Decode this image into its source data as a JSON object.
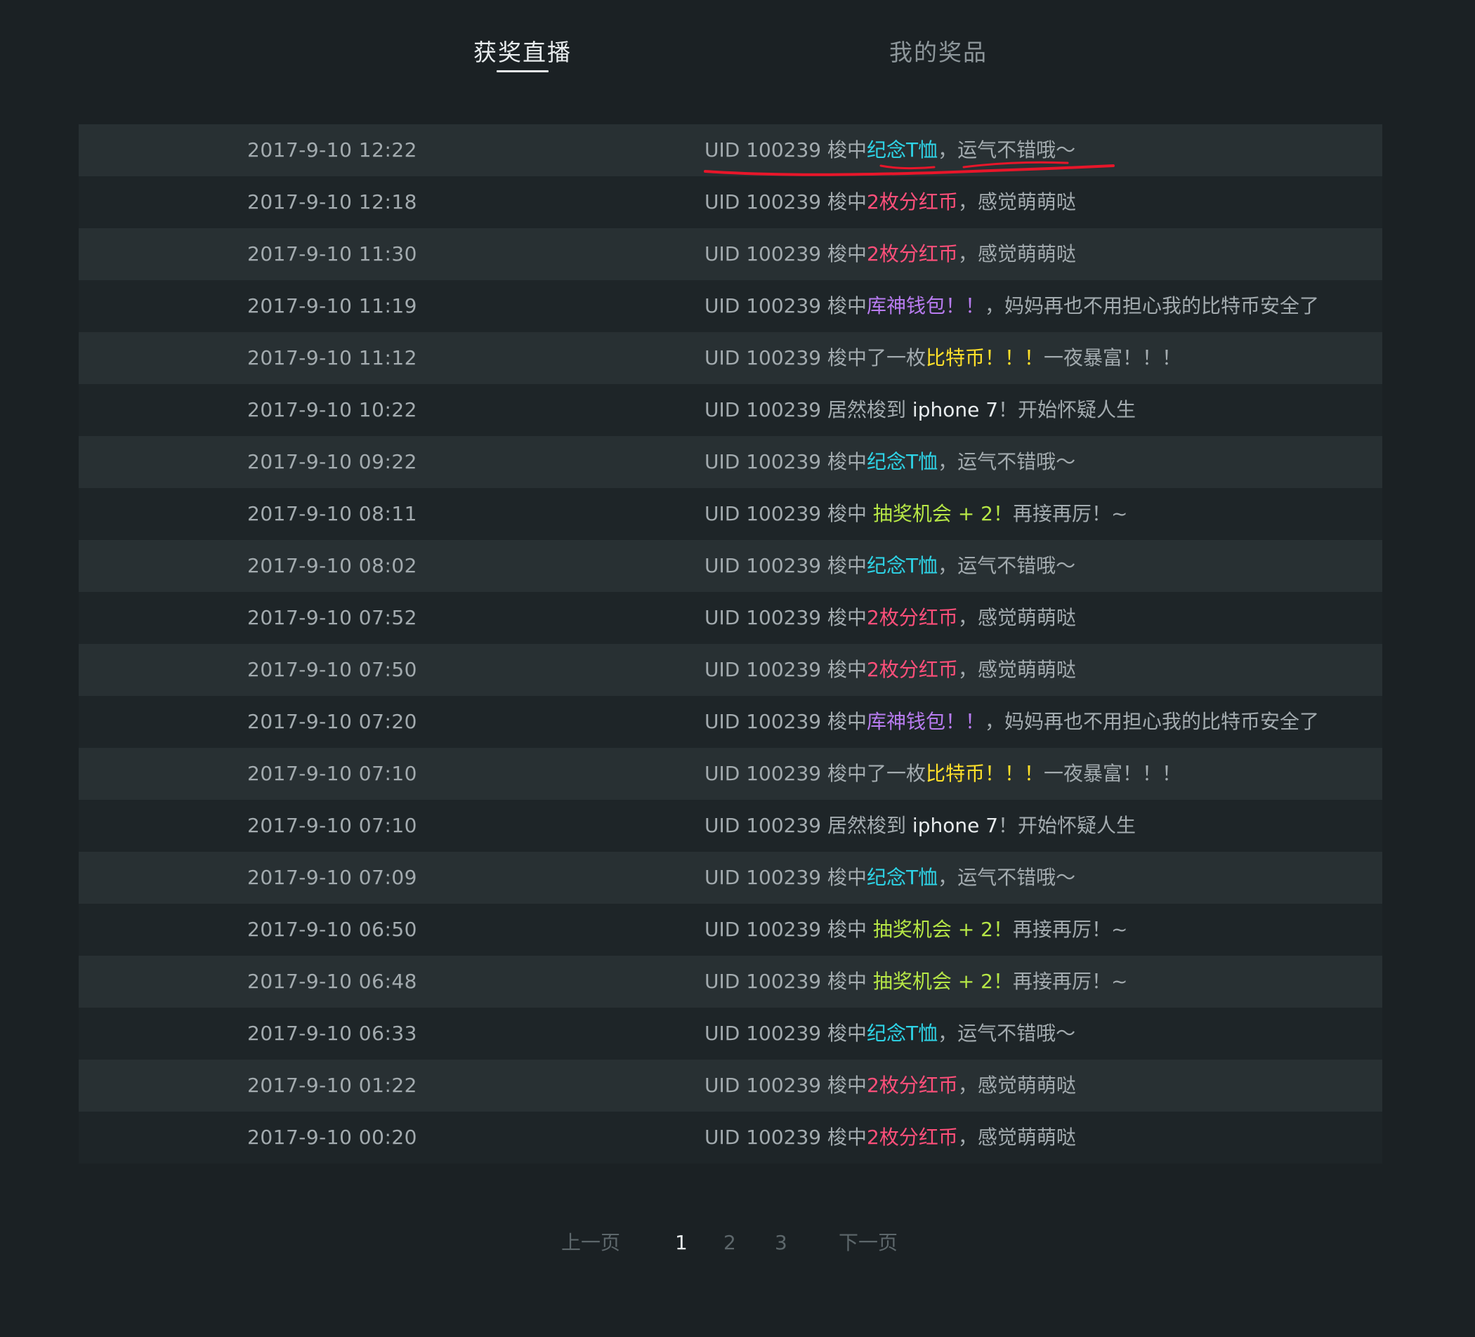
{
  "tabs": {
    "live": "获奖直播",
    "prize": "我的奖品"
  },
  "colors": {
    "tshirt": "#2ed3e6",
    "coin": "#ff4f7a",
    "wallet": "#b87cf0",
    "bitcoin": "#ffe02a",
    "chance": "#b6e646",
    "iphone": "#e8ecee",
    "annotation": "#e8162a"
  },
  "rows": [
    {
      "time": "2017-9-10  12:22",
      "uid": "UID 100239",
      "pre": "梭中",
      "prize": "纪念T恤",
      "type": "tshirt",
      "post": "，运气不错哦～"
    },
    {
      "time": "2017-9-10  12:18",
      "uid": "UID 100239",
      "pre": "梭中",
      "prize": "2枚分红币",
      "type": "coin",
      "post": "，感觉萌萌哒"
    },
    {
      "time": "2017-9-10  11:30",
      "uid": "UID 100239",
      "pre": "梭中",
      "prize": "2枚分红币",
      "type": "coin",
      "post": "，感觉萌萌哒"
    },
    {
      "time": "2017-9-10  11:19",
      "uid": "UID 100239",
      "pre": "梭中",
      "prize": "库神钱包！！",
      "type": "wallet",
      "post": "，妈妈再也不用担心我的比特币安全了"
    },
    {
      "time": "2017-9-10  11:12",
      "uid": "UID 100239",
      "pre": "梭中了一枚",
      "prize": "比特币！！！",
      "type": "bitcoin",
      "post": "一夜暴富！！！"
    },
    {
      "time": "2017-9-10  10:22",
      "uid": "UID 100239",
      "pre": "居然梭到 ",
      "prize": "iphone 7",
      "type": "iphone",
      "post": "！开始怀疑人生"
    },
    {
      "time": "2017-9-10  09:22",
      "uid": "UID 100239",
      "pre": "梭中",
      "prize": "纪念T恤",
      "type": "tshirt",
      "post": "，运气不错哦～"
    },
    {
      "time": "2017-9-10  08:11",
      "uid": "UID 100239",
      "pre": "梭中 ",
      "prize": "抽奖机会 + 2！",
      "type": "chance",
      "post": "再接再厉！~"
    },
    {
      "time": "2017-9-10  08:02",
      "uid": "UID 100239",
      "pre": "梭中",
      "prize": "纪念T恤",
      "type": "tshirt",
      "post": "，运气不错哦～"
    },
    {
      "time": "2017-9-10  07:52",
      "uid": "UID 100239",
      "pre": "梭中",
      "prize": "2枚分红币",
      "type": "coin",
      "post": "，感觉萌萌哒"
    },
    {
      "time": "2017-9-10  07:50",
      "uid": "UID 100239",
      "pre": "梭中",
      "prize": "2枚分红币",
      "type": "coin",
      "post": "，感觉萌萌哒"
    },
    {
      "time": "2017-9-10  07:20",
      "uid": "UID 100239",
      "pre": "梭中",
      "prize": "库神钱包！！",
      "type": "wallet",
      "post": "，妈妈再也不用担心我的比特币安全了"
    },
    {
      "time": "2017-9-10  07:10",
      "uid": "UID 100239",
      "pre": "梭中了一枚",
      "prize": "比特币！！！",
      "type": "bitcoin",
      "post": "一夜暴富！！！"
    },
    {
      "time": "2017-9-10  07:10",
      "uid": "UID 100239",
      "pre": "居然梭到 ",
      "prize": "iphone 7",
      "type": "iphone",
      "post": "！开始怀疑人生"
    },
    {
      "time": "2017-9-10  07:09",
      "uid": "UID 100239",
      "pre": "梭中",
      "prize": "纪念T恤",
      "type": "tshirt",
      "post": "，运气不错哦～"
    },
    {
      "time": "2017-9-10  06:50",
      "uid": "UID 100239",
      "pre": "梭中 ",
      "prize": "抽奖机会 + 2！",
      "type": "chance",
      "post": "再接再厉！~"
    },
    {
      "time": "2017-9-10  06:48",
      "uid": "UID 100239",
      "pre": "梭中 ",
      "prize": "抽奖机会 + 2！",
      "type": "chance",
      "post": "再接再厉！~"
    },
    {
      "time": "2017-9-10  06:33",
      "uid": "UID 100239",
      "pre": "梭中",
      "prize": "纪念T恤",
      "type": "tshirt",
      "post": "，运气不错哦～"
    },
    {
      "time": "2017-9-10  01:22",
      "uid": "UID 100239",
      "pre": "梭中",
      "prize": "2枚分红币",
      "type": "coin",
      "post": "，感觉萌萌哒"
    },
    {
      "time": "2017-9-10  00:20",
      "uid": "UID 100239",
      "pre": "梭中",
      "prize": "2枚分红币",
      "type": "coin",
      "post": "，感觉萌萌哒"
    }
  ],
  "pagination": {
    "prev": "上一页",
    "pages": [
      "1",
      "2",
      "3"
    ],
    "current": "1",
    "next": "下一页"
  }
}
